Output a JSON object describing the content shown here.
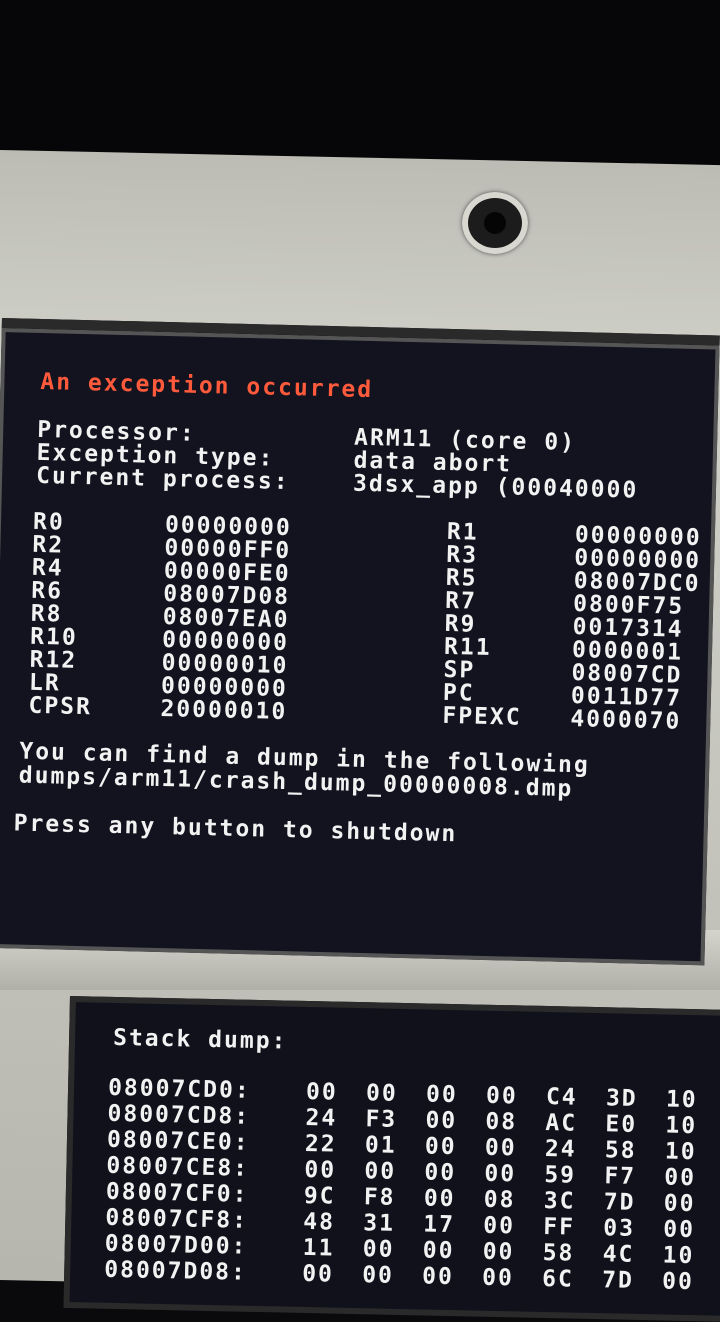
{
  "top_screen": {
    "title": "An exception occurred",
    "info": [
      {
        "label": "Processor:",
        "value": "ARM11 (core 0)"
      },
      {
        "label": "Exception type:",
        "value": "data abort"
      },
      {
        "label": "Current process:",
        "value": "3dsx_app (00040000"
      }
    ],
    "registers_left": [
      {
        "name": "R0",
        "value": "00000000"
      },
      {
        "name": "R2",
        "value": "00000FF0"
      },
      {
        "name": "R4",
        "value": "00000FE0"
      },
      {
        "name": "R6",
        "value": "08007D08"
      },
      {
        "name": "R8",
        "value": "08007EA0"
      },
      {
        "name": "R10",
        "value": "00000000"
      },
      {
        "name": "R12",
        "value": "00000010"
      },
      {
        "name": "LR",
        "value": "00000000"
      },
      {
        "name": "CPSR",
        "value": "20000010"
      }
    ],
    "registers_right": [
      {
        "name": "R1",
        "value": "00000000"
      },
      {
        "name": "R3",
        "value": "00000000"
      },
      {
        "name": "R5",
        "value": "08007DC0"
      },
      {
        "name": "R7",
        "value": "0800F75"
      },
      {
        "name": "R9",
        "value": "0017314"
      },
      {
        "name": "R11",
        "value": "0000001"
      },
      {
        "name": "SP",
        "value": "08007CD"
      },
      {
        "name": "PC",
        "value": "0011D77"
      },
      {
        "name": "FPEXC",
        "value": "4000070"
      }
    ],
    "dump_line1": "You can find a dump in the following",
    "dump_line2": "dumps/arm11/crash_dump_00000008.dmp",
    "prompt": "Press any button to shutdown"
  },
  "bottom_screen": {
    "title": "Stack dump:",
    "rows": [
      {
        "addr": "08007CD0:",
        "bytes": [
          "00",
          "00",
          "00",
          "00",
          "C4",
          "3D",
          "10"
        ]
      },
      {
        "addr": "08007CD8:",
        "bytes": [
          "24",
          "F3",
          "00",
          "08",
          "AC",
          "E0",
          "10"
        ]
      },
      {
        "addr": "08007CE0:",
        "bytes": [
          "22",
          "01",
          "00",
          "00",
          "24",
          "58",
          "10"
        ]
      },
      {
        "addr": "08007CE8:",
        "bytes": [
          "00",
          "00",
          "00",
          "00",
          "59",
          "F7",
          "00"
        ]
      },
      {
        "addr": "08007CF0:",
        "bytes": [
          "9C",
          "F8",
          "00",
          "08",
          "3C",
          "7D",
          "00"
        ]
      },
      {
        "addr": "08007CF8:",
        "bytes": [
          "48",
          "31",
          "17",
          "00",
          "FF",
          "03",
          "00"
        ]
      },
      {
        "addr": "08007D00:",
        "bytes": [
          "11",
          "00",
          "00",
          "00",
          "58",
          "4C",
          "10"
        ]
      },
      {
        "addr": "08007D08:",
        "bytes": [
          "00",
          "00",
          "00",
          "00",
          "6C",
          "7D",
          "00"
        ]
      }
    ]
  }
}
